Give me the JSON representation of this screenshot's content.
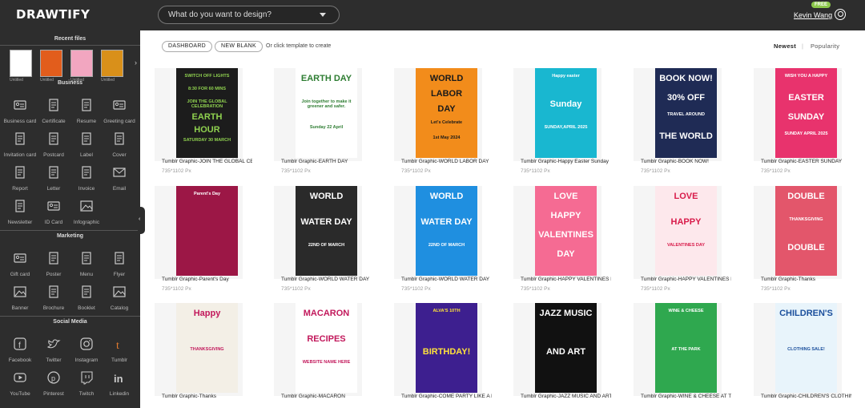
{
  "header": {
    "logo": "DRAWTIFY",
    "search_placeholder": "What do you want to design?",
    "badge": "FREE",
    "user_name": "Kevin Wang"
  },
  "sidebar": {
    "recent_title": "Recent files",
    "recent": [
      {
        "label": "Untitled"
      },
      {
        "label": "Untitled"
      },
      {
        "label": "Untitled"
      },
      {
        "label": "Untitled"
      }
    ],
    "sections": [
      {
        "title": "Business",
        "items": [
          "Business card",
          "Certificate",
          "Resume",
          "Greeting card",
          "Invitation card",
          "Postcard",
          "Label",
          "Cover",
          "Report",
          "Letter",
          "Invoice",
          "Email",
          "Newsletter",
          "ID Card",
          "Infographic"
        ]
      },
      {
        "title": "Marketing",
        "items": [
          "Gift card",
          "Poster",
          "Menu",
          "Flyer",
          "Banner",
          "Brochure",
          "Booklet",
          "Catalog"
        ]
      },
      {
        "title": "Social Media",
        "items": [
          "Facebook",
          "Twitter",
          "Instagram",
          "Tumblr",
          "YouTube",
          "Pinterest",
          "Twitch",
          "Linkedin"
        ]
      }
    ]
  },
  "toolbar": {
    "dashboard": "DASHBOARD",
    "new_blank": "NEW BLANK",
    "hint": "Or click template to create",
    "sort_newest": "Newest",
    "sort_sep": "|",
    "sort_popularity": "Popularity"
  },
  "templates": [
    {
      "title": "Tumblr Graphic-JOIN THE GLOBAL CELEBRATION",
      "size": "735*1102 Px",
      "bg": "#1c1c1c",
      "fg": "#8fd14f",
      "lines": [
        "SWITCH OFF LIGHTS",
        "8:30 FOR 60 MINS",
        "JOIN THE GLOBAL CELEBRATION",
        "EARTH",
        "HOUR",
        "SATURDAY 30 MARCH"
      ]
    },
    {
      "title": "Tumblr Graphic-EARTH DAY",
      "size": "735*1102 Px",
      "bg": "#ffffff",
      "fg": "#2e7d32",
      "lines": [
        "EARTH DAY",
        "Join together to make it greener and safer.",
        "Sunday 22 April"
      ]
    },
    {
      "title": "Tumblr Graphic-WORLD LABOR DAY",
      "size": "735*1102 Px",
      "bg": "#f28c1b",
      "fg": "#1a1a1a",
      "lines": [
        "WORLD",
        "LABOR",
        "DAY",
        "Let's Celebrate",
        "1st May 2024"
      ]
    },
    {
      "title": "Tumblr Graphic-Happy Easter Sunday",
      "size": "735*1102 Px",
      "bg": "#19b7d0",
      "fg": "#ffffff",
      "lines": [
        "Happy easter",
        "Sunday",
        "SUNDAY,APRIL 2025"
      ]
    },
    {
      "title": "Tumblr Graphic-BOOK NOW!",
      "size": "735*1102 Px",
      "bg": "#1f2b55",
      "fg": "#ffffff",
      "lines": [
        "BOOK NOW!",
        "30% OFF",
        "TRAVEL AROUND",
        "THE WORLD"
      ]
    },
    {
      "title": "Tumblr Graphic-EASTER SUNDAY",
      "size": "735*1102 Px",
      "bg": "#e8336d",
      "fg": "#ffffff",
      "lines": [
        "WISH YOU A HAPPY",
        "EASTER",
        "SUNDAY",
        "SUNDAY APRIL 2025"
      ]
    },
    {
      "title": "Tumblr Graphic-Parent's Day",
      "size": "735*1102 Px",
      "bg": "#9c1746",
      "fg": "#ffffff",
      "lines": [
        "Parent's Day"
      ]
    },
    {
      "title": "Tumblr Graphic-WORLD WATER DAY",
      "size": "735*1102 Px",
      "bg": "#2a2a2a",
      "fg": "#ffffff",
      "lines": [
        "WORLD",
        "WATER DAY",
        "22ND OF MARCH"
      ]
    },
    {
      "title": "Tumblr Graphic-WORLD WATER DAY",
      "size": "735*1102 Px",
      "bg": "#1f8fe0",
      "fg": "#ffffff",
      "lines": [
        "WORLD",
        "WATER DAY",
        "22ND OF MARCH"
      ]
    },
    {
      "title": "Tumblr Graphic-HAPPY VALENTINES DAY",
      "size": "735*1102 Px",
      "bg": "#f56b93",
      "fg": "#ffffff",
      "lines": [
        "LOVE",
        "HAPPY",
        "VALENTINES",
        "DAY"
      ]
    },
    {
      "title": "Tumblr Graphic-HAPPY VALENTINES DAY",
      "size": "735*1102 Px",
      "bg": "#fde8ec",
      "fg": "#d81b4a",
      "lines": [
        "LOVE",
        "HAPPY",
        "VALENTINES DAY"
      ]
    },
    {
      "title": "Tumblr Graphic-Thanks",
      "size": "735*1102 Px",
      "bg": "#e3566b",
      "fg": "#ffffff",
      "lines": [
        "DOUBLE",
        "THANKSGIVING",
        "DOUBLE"
      ]
    },
    {
      "title": "Tumblr Graphic-Thanks",
      "size": "735*1102 Px",
      "bg": "#f3efe6",
      "fg": "#c2185b",
      "lines": [
        "Happy",
        "THANKSGIVING"
      ]
    },
    {
      "title": "Tumblr Graphic-MACARON",
      "size": "735*1102 Px",
      "bg": "#ffffff",
      "fg": "#c2185b",
      "lines": [
        "MACARON",
        "RECIPES",
        "WEBSITE NAME HERE"
      ]
    },
    {
      "title": "Tumblr Graphic-COME PARTY LIKE A ROCKSTAR",
      "size": "735*1102 Px",
      "bg": "#3d1f8f",
      "fg": "#ffe23b",
      "lines": [
        "ALVA'S 10TH",
        "BIRTHDAY!"
      ]
    },
    {
      "title": "Tumblr Graphic-JAZZ MUSIC AND ART",
      "size": "735*1102 Px",
      "bg": "#111111",
      "fg": "#ffffff",
      "lines": [
        "JAZZ MUSIC",
        "AND ART"
      ]
    },
    {
      "title": "Tumblr Graphic-WINE & CHEESE AT THE PARK",
      "size": "735*1102 Px",
      "bg": "#2fa84f",
      "fg": "#ffffff",
      "lines": [
        "WINE & CHEESE",
        "AT THE PARK"
      ]
    },
    {
      "title": "Tumblr Graphic-CHILDREN'S CLOTHING SALE",
      "size": "735*1102 Px",
      "bg": "#e8f4fb",
      "fg": "#1b4f9c",
      "lines": [
        "CHILDREN'S",
        "CLOTHING SALE!"
      ]
    }
  ]
}
